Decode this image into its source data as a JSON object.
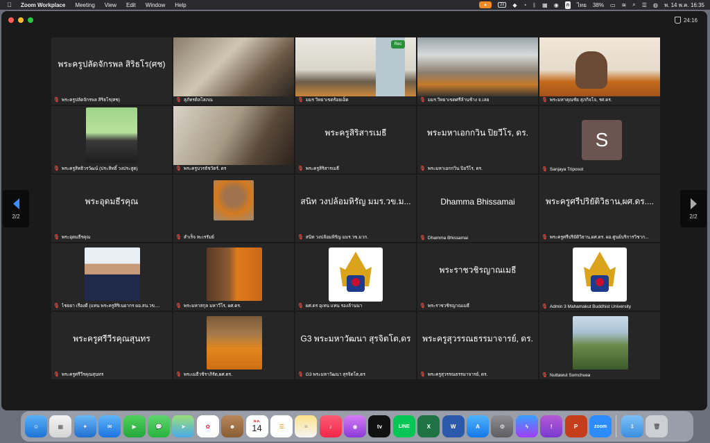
{
  "menubar": {
    "app_name": "Zoom Workplace",
    "items": [
      "Meeting",
      "View",
      "Edit",
      "Window",
      "Help"
    ],
    "status": {
      "display": "2x",
      "input_lang": "ไทย",
      "battery": "38%",
      "datetime": "พ. 14 พ.ค. 16:35"
    }
  },
  "window": {
    "timer": "24:16"
  },
  "pagination": {
    "prev": "2/2",
    "next": "2/2"
  },
  "tiles": [
    {
      "center": "พระครูปลัดจักรพล สิริธโร(ศช)",
      "label": "พระครูปลัดจักรพล สิริธโร(ศช)"
    },
    {
      "center": "",
      "label": "สุภัทรดิลโสภณ"
    },
    {
      "center": "",
      "label": "มมร วิทยาเขตร้อยเอ็ด"
    },
    {
      "center": "",
      "label": "มมร.วิทยาเขตศรีล้านช้าง จ.เลย"
    },
    {
      "center": "",
      "label": "พระมหาคุณชัย สุภกิจโจ, รศ.ดร."
    },
    {
      "center": "",
      "label": "พระครูสิทธิวรวัฒน์ (ประสิทธิ์ วงประสูต)"
    },
    {
      "center": "",
      "label": "พระครูบวรธัชวัตร์, ดร"
    },
    {
      "center": "พระครูสิริสารเมธี",
      "label": "พระครูสิริสารเมธี"
    },
    {
      "center": "พระมหาเอกกวิน ปิยวีโร, ดร.",
      "label": "พระมหาเอกกวิน ปิยวีโร, ดร."
    },
    {
      "center": "",
      "label": "Sanjaya Triposot",
      "avatar": "S"
    },
    {
      "center": "พระอุดมธีรคุณ",
      "label": "พระอุดมธีรคุณ"
    },
    {
      "center": "",
      "label": "สำเร็จ ทะเรรัมย์"
    },
    {
      "center": "สนิท วงปล้อมหิรัญ มมร.วข.ม...",
      "label": "สนิท วงปล้อมหิรัญ มมร.วข.มวก."
    },
    {
      "center": "Dhamma Bhissamai",
      "label": "Dhamma Bhissamai"
    },
    {
      "center": "พระครูศรีปริยัติวิธาน,ผศ.ดร....",
      "label": "พระครูศรีปริยัติวิธาน,ผศ.ดร. ผอ.ศูนย์บริการวิชาก..."
    },
    {
      "center": "",
      "label": "ไชยยา เรืองดี (แทน พระครูสิริเนยากร ผอ.สน.วข...."
    },
    {
      "center": "",
      "label": "พระมหาสกุล มหาวีโร, ผศ.ดร."
    },
    {
      "center": "",
      "label": "ผศ.ดร อุเทน แทน รองล้านนา"
    },
    {
      "center": "พระราชวชิรญาณเมธี",
      "label": "พระราชวชิรญาณเมธี"
    },
    {
      "center": "",
      "label": "Admin 3 Mahamakut Buddhist University"
    },
    {
      "center": "พระครูศรีวีรคุณสุนทร",
      "label": "พระครูศรีวีรคุณสุนทร"
    },
    {
      "center": "",
      "label": "พระเมธีวชิราภิรัต,ผศ.ดร."
    },
    {
      "center": "G3 พระมหาวัฒนา สุรจิตโต,ดร",
      "label": "G3 พระมหาวัฒนา สุรจิตโต,ดร"
    },
    {
      "center": "พระครูสุวรรณธรรมาจารย์, ดร.",
      "label": "พระครูสุวรรณธรรมาจารย์, ดร."
    },
    {
      "center": "",
      "label": "Nuttawut Somchuea"
    }
  ],
  "overlay_text": {
    "rec_badge": "Rec",
    "calendar_month": "พ.ค.",
    "calendar_day": "14",
    "line": "LINE",
    "zoom": "zoom"
  },
  "colors": {
    "accent": "#3a8ef6",
    "muted": "#e0443a",
    "tile_bg": "#262626"
  }
}
